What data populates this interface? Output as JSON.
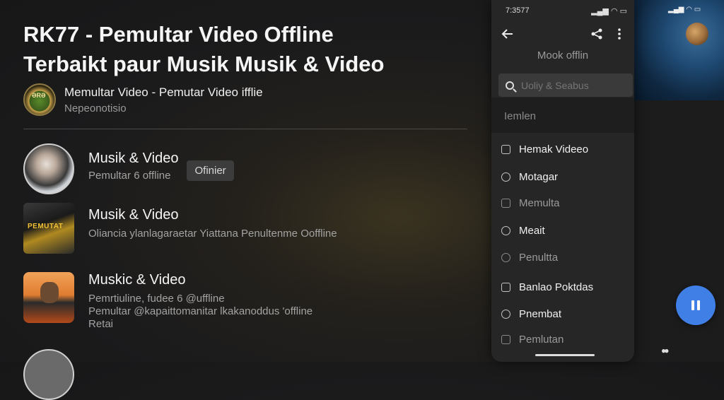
{
  "header": {
    "title_line1": "RK77 - Pemultar Video Offline",
    "title_line2": "Terbaikt paur Musik Musik & Video"
  },
  "channel": {
    "avatar_text": "ƏRƏ",
    "name": "Memultar Video - Pemutar Video ifflie",
    "subtitle": "Nepeonotisio"
  },
  "list": [
    {
      "title": "Musik & Video",
      "subtitle": "Pemultar 6 offline",
      "badge": "Ofinier"
    },
    {
      "title": "Musik & Video",
      "subtitle": "Oliancia ylanlagaraetar Yiattana Penultenme Ooffline",
      "thumb_text": "PEMUTAT"
    },
    {
      "title": "Muskic & Video",
      "subtitle_lines": [
        "Pemrtiuline, fudee 6 @uffline",
        "Pemultar @kapaittomanitar lkakanoddus 'offline",
        "Retai"
      ]
    }
  ],
  "phone": {
    "status_time": "7:3577",
    "status_right": "▂▄▆ ◠ ▭",
    "back_icon": "back-arrow-icon",
    "header_subtitle": "Mook offlin",
    "search_placeholder": "Uoliy & Seabus",
    "section_label": "Iemlen",
    "menu": [
      {
        "label": "Hemak Videeo",
        "state": "bright",
        "icon": "clock-icon"
      },
      {
        "label": "Motagar",
        "state": "bright",
        "icon": "circle-icon"
      },
      {
        "label": "Memulta",
        "state": "dim",
        "icon": "square-icon"
      },
      {
        "label": "Meait",
        "state": "bright",
        "icon": "check-icon"
      },
      {
        "label": "Penultta",
        "state": "dim",
        "icon": "shield-icon"
      },
      {
        "label": "Banlao Poktdas",
        "state": "bright",
        "icon": "clock-icon"
      },
      {
        "label": "Pnembat",
        "state": "bright",
        "icon": "check-icon"
      },
      {
        "label": "Pemlutan",
        "state": "dim",
        "icon": "square-icon"
      }
    ]
  },
  "side": {
    "status": "▂▄▆ ◠ ▭"
  },
  "colors": {
    "fab": "#3f7fe6",
    "background": "#1b1b1c"
  }
}
